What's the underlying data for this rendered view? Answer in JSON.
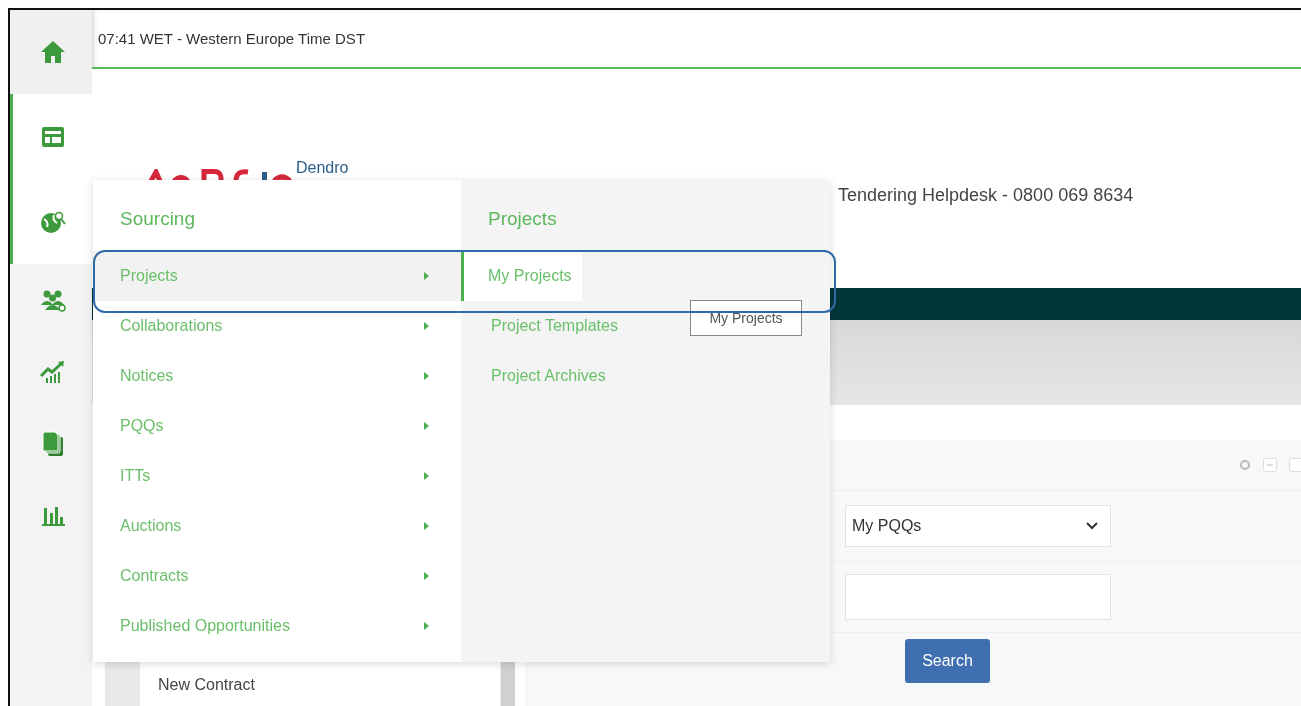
{
  "top_bar": {
    "time_zone": "07:41 WET - Western Europe Time DST"
  },
  "nav_rail": [
    {
      "kind": "home",
      "selected": false
    },
    {
      "kind": "layout",
      "selected": true
    },
    {
      "kind": "globe",
      "selected": true
    },
    {
      "kind": "people",
      "selected": false
    },
    {
      "kind": "growth",
      "selected": false
    },
    {
      "kind": "documents",
      "selected": false
    },
    {
      "kind": "bars",
      "selected": false
    }
  ],
  "header": {
    "logo_text": "Dendro",
    "helpdesk": "Tendering Helpdesk - 0800 069 8634"
  },
  "side_list": [
    "New Contract"
  ],
  "panel": {
    "select": {
      "value": "My PQQs"
    },
    "search_button": "Search"
  },
  "menu": {
    "title": "Sourcing",
    "items": [
      {
        "label": "Projects",
        "selected": true
      },
      {
        "label": "Collaborations",
        "selected": false
      },
      {
        "label": "Notices",
        "selected": false
      },
      {
        "label": "PQQs",
        "selected": false
      },
      {
        "label": "ITTs",
        "selected": false
      },
      {
        "label": "Auctions",
        "selected": false
      },
      {
        "label": "Contracts",
        "selected": false
      },
      {
        "label": "Published Opportunities",
        "selected": false
      }
    ],
    "submenu": {
      "title": "Projects",
      "items": [
        {
          "label": "My Projects",
          "selected": true
        },
        {
          "label": "Project Templates",
          "selected": false
        },
        {
          "label": "Project Archives",
          "selected": false
        }
      ]
    }
  },
  "tooltip": "My Projects"
}
